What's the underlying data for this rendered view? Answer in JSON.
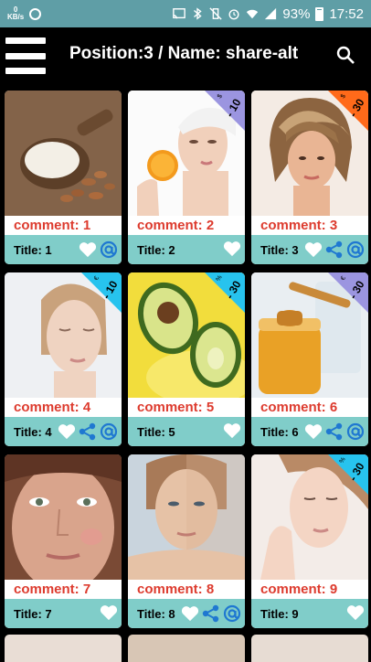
{
  "status": {
    "kbps_top": "0",
    "kbps_bottom": "KB/s",
    "battery": "93%",
    "time": "17:52",
    "icons": [
      "circle-icon",
      "cast-icon",
      "bluetooth-icon",
      "vibrate-off-icon",
      "alarm-icon",
      "wifi-icon",
      "signal-icon",
      "battery-icon"
    ]
  },
  "appbar": {
    "title": "Position:3 / Name: share-alt",
    "menu_icon": "menu-icon",
    "search_icon": "search-icon"
  },
  "cards": [
    {
      "comment": "comment: 1",
      "title": "Title: 1",
      "badge": null,
      "share": true
    },
    {
      "comment": "comment: 2",
      "title": "Title: 2",
      "badge": {
        "text": "- 10",
        "currency": "$",
        "color": "#9b95e0"
      },
      "share": false
    },
    {
      "comment": "comment: 3",
      "title": "Title: 3",
      "badge": {
        "text": "- 30",
        "currency": "$",
        "color": "#ff6a1a"
      },
      "share": true
    },
    {
      "comment": "comment: 4",
      "title": "Title: 4",
      "badge": {
        "text": "- 10",
        "currency": "€",
        "color": "#27c3ee"
      },
      "share": true
    },
    {
      "comment": "comment: 5",
      "title": "Title: 5",
      "badge": {
        "text": "- 30",
        "currency": "%",
        "color": "#27c3ee"
      },
      "share": false
    },
    {
      "comment": "comment: 6",
      "title": "Title: 6",
      "badge": {
        "text": "- 30",
        "currency": "€",
        "color": "#9b95e0"
      },
      "share": true
    },
    {
      "comment": "comment: 7",
      "title": "Title: 7",
      "badge": null,
      "share": false
    },
    {
      "comment": "comment: 8",
      "title": "Title: 8",
      "badge": null,
      "share": true
    },
    {
      "comment": "comment: 9",
      "title": "Title: 9",
      "badge": {
        "text": "- 30",
        "currency": "%",
        "color": "#27c3ee"
      },
      "share": false
    }
  ]
}
